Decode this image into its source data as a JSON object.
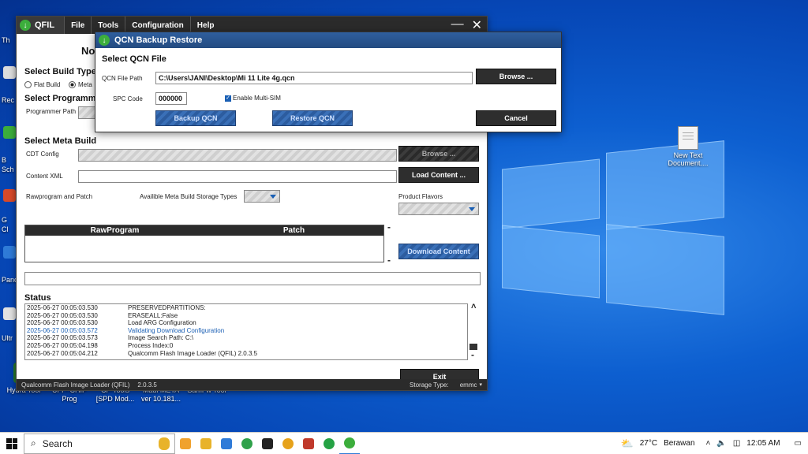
{
  "desktop": {
    "left_fragments": [
      "Th",
      "Rec",
      "B",
      "Sch",
      "G",
      "Cl",
      "Panc",
      "Ultr"
    ],
    "file_icon": {
      "line1": "New Text",
      "line2": "Document...."
    },
    "bottom_icons": [
      {
        "label": "Hydra Tool",
        "color": "#2a7c2a"
      },
      {
        "label": "UFI - CHIP Prog",
        "color": "#1b5fae"
      },
      {
        "label": "CF-Tools [SPD Mod...",
        "color": "#c53b2a"
      },
      {
        "label": "Maui META ver 10.181...",
        "color": "#555555"
      },
      {
        "label": "SamFw Tool",
        "color": "#1a74c9"
      }
    ]
  },
  "qfil": {
    "app_name": "QFIL",
    "menu": [
      "File",
      "Tools",
      "Configuration",
      "Help"
    ],
    "minimize": "—",
    "close": "✕",
    "no_text": "No",
    "select_build_type": "Select Build Type",
    "flat_build": "Flat Build",
    "meta_build": "Meta",
    "select_programmer": "Select Programm",
    "programmer_path": "Programmer Path",
    "select_meta_build": "Select Meta Build",
    "cdt_config": "CDT Config",
    "browse": "Browse ...",
    "content_xml": "Content XML",
    "load_content": "Load Content ...",
    "rawprogram_and_patch": "Rawprogram and Patch",
    "storage_types_label": "Availible Meta Build Storage Types",
    "product_flavors": "Product Flavors",
    "table_headers": [
      "RawProgram",
      "Patch"
    ],
    "download_content": "Download Content",
    "dash": "-",
    "status_label": "Status",
    "status_lines": [
      {
        "ts": "2025-06-27 00:05:03.530",
        "msg": "PRESERVEDPARTITIONS:",
        "blue": false
      },
      {
        "ts": "2025-06-27 00:05:03.530",
        "msg": "ERASEALL:False",
        "blue": false
      },
      {
        "ts": "2025-06-27 00:05:03.530",
        "msg": "Load ARG Configuration",
        "blue": false
      },
      {
        "ts": "2025-06-27 00:05:03.572",
        "msg": "Validating Download Configuration",
        "blue": true
      },
      {
        "ts": "2025-06-27 00:05:03.573",
        "msg": "Image Search Path: C:\\",
        "blue": false
      },
      {
        "ts": "2025-06-27 00:05:04.198",
        "msg": "Process Index:0",
        "blue": false
      },
      {
        "ts": "2025-06-27 00:05:04.212",
        "msg": "Qualcomm Flash Image Loader (QFIL) 2.0.3.5",
        "blue": false
      }
    ],
    "scroll_up": "˄",
    "exit": "Exit",
    "footer_name": "Qualcomm Flash Image Loader (QFIL)",
    "footer_version": "2.0.3.5",
    "storage_type_label": "Storage Type:",
    "storage_type_value": "emmc"
  },
  "qcn": {
    "title": "QCN Backup Restore",
    "select_file": "Select QCN File",
    "file_path_label": "QCN File Path",
    "file_path_value": "C:\\Users\\JANI\\Desktop\\Mi 11 Lite 4g.qcn",
    "browse": "Browse ...",
    "spc_label": "SPC Code",
    "spc_value": "000000",
    "multi_sim": "Enable Multi-SIM",
    "backup": "Backup QCN",
    "restore": "Restore QCN",
    "cancel": "Cancel"
  },
  "taskbar": {
    "search": "Search",
    "apps": [
      "#f0a22e",
      "#2f7bd8",
      "#e8b32a",
      "#2fa14a",
      "#222222",
      "#e6a21a",
      "#c0392b",
      "#25a244",
      "#3cae3c"
    ],
    "temperature": "27°C",
    "weather": "Berawan",
    "time": "12:05 AM"
  }
}
